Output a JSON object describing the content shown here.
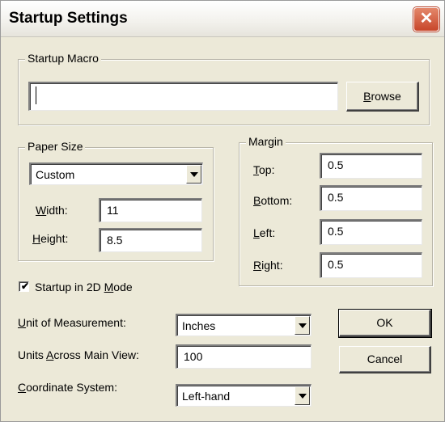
{
  "window": {
    "title": "Startup Settings",
    "close_symbol": "✕"
  },
  "startup_macro": {
    "legend": "Startup Macro",
    "value": "",
    "browse_label": "Browse",
    "browse_mnemonic": "B",
    "browse_rest": "rowse"
  },
  "paper_size": {
    "legend": "Paper Size",
    "selected": "Custom",
    "width_mnemonic": "W",
    "width_rest": "idth:",
    "width_value": "11",
    "height_mnemonic": "H",
    "height_rest": "eight:",
    "height_value": "8.5"
  },
  "margin": {
    "legend": "Margin",
    "top_mnemonic": "T",
    "top_rest": "op:",
    "top_value": "0.5",
    "bottom_mnemonic": "B",
    "bottom_rest": "ottom:",
    "bottom_value": "0.5",
    "left_mnemonic": "L",
    "left_rest": "eft:",
    "left_value": "0.5",
    "right_mnemonic": "R",
    "right_rest": "ight:",
    "right_value": "0.5"
  },
  "startup_2d": {
    "checked": true,
    "label_prefix": "Startup in 2D ",
    "label_mnemonic": "M",
    "label_rest": "ode",
    "check_symbol": "✔"
  },
  "unit_of_measurement": {
    "label_mnemonic": "U",
    "label_rest": "nit of Measurement:",
    "selected": "Inches"
  },
  "units_across": {
    "label_prefix": "Units ",
    "label_mnemonic": "A",
    "label_rest": "cross Main View:",
    "value": "100"
  },
  "coordinate_system": {
    "label_mnemonic": "C",
    "label_rest": "oordinate System:",
    "selected": "Left-hand"
  },
  "buttons": {
    "ok": "OK",
    "cancel": "Cancel"
  },
  "colors": {
    "dialog_bg": "#ece9d8",
    "close_button": "#c8462a"
  }
}
